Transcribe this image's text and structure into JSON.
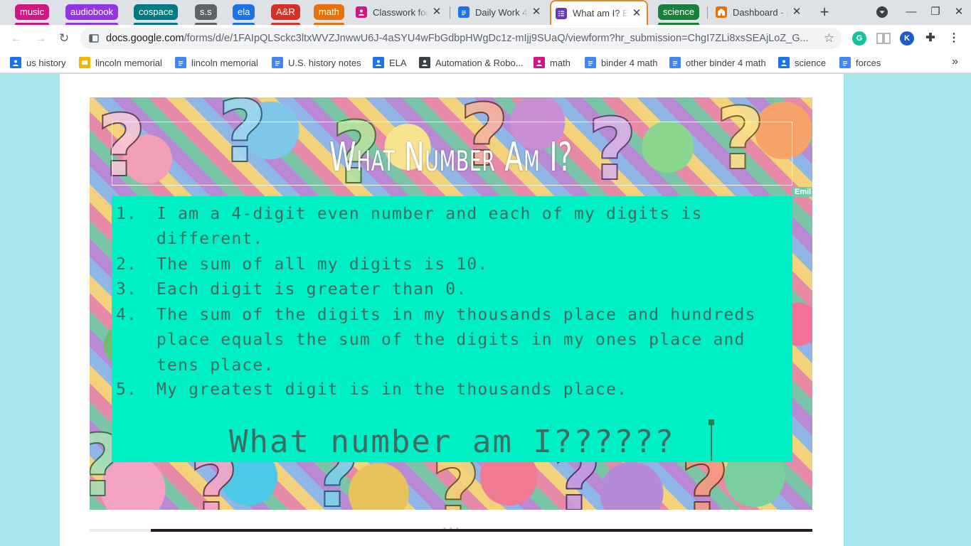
{
  "tab_groups": [
    {
      "label": "music",
      "color": "#d01884"
    },
    {
      "label": "audiobook",
      "color": "#9334e6"
    },
    {
      "label": "cospace",
      "color": "#007b83"
    },
    {
      "label": "s.s",
      "color": "#5f6368"
    },
    {
      "label": "ela",
      "color": "#1a73e8"
    },
    {
      "label": "A&R",
      "color": "#d93025"
    },
    {
      "label": "math",
      "color": "#e8710a"
    },
    {
      "label": "science",
      "color": "#188038"
    }
  ],
  "tabs": [
    {
      "title": "Classwork for",
      "favicon_color": "#d01884"
    },
    {
      "title": "Daily Work 4/",
      "favicon_color": "#1a73e8"
    },
    {
      "title": "What am I? E",
      "favicon_color": "#673ab7"
    },
    {
      "title": "Dashboard - I",
      "favicon_color": "#e8710a"
    }
  ],
  "toolbar": {
    "url_host": "docs.google.com",
    "url_path": "/forms/d/e/1FAIpQLSckc3ltxWVZJnwwU6J-4aSYU4wFbGdbpHWgDc1z-mIjj9SUaQ/viewform?hr_submission=ChgI7ZLi8xsSEAjLoZ_G..."
  },
  "extensions": [
    {
      "name": "grammarly-icon",
      "color": "#15c39a",
      "letter": "G"
    },
    {
      "name": "reading-list-icon",
      "color": "#ffffff",
      "letter": ""
    },
    {
      "name": "k-extension-icon",
      "color": "#1a5dc9",
      "letter": "K"
    }
  ],
  "bookmarks": [
    {
      "label": "us history",
      "icon": "classroom",
      "color": "#1a73e8"
    },
    {
      "label": "lincoln memorial",
      "icon": "slides",
      "color": "#f4b400"
    },
    {
      "label": "lincoln memorial",
      "icon": "docs",
      "color": "#4285f4"
    },
    {
      "label": "U.S. history notes",
      "icon": "docs",
      "color": "#4285f4"
    },
    {
      "label": "ELA",
      "icon": "classroom",
      "color": "#1a73e8"
    },
    {
      "label": "Automation & Robo...",
      "icon": "classroom",
      "color": "#3c4043"
    },
    {
      "label": "math",
      "icon": "classroom",
      "color": "#d01884"
    },
    {
      "label": "binder 4 math",
      "icon": "docs",
      "color": "#4285f4"
    },
    {
      "label": "other binder 4 math",
      "icon": "docs",
      "color": "#4285f4"
    },
    {
      "label": "science",
      "icon": "classroom",
      "color": "#1a73e8"
    },
    {
      "label": "forces",
      "icon": "docs",
      "color": "#4285f4"
    }
  ],
  "form": {
    "header_title": "What Number Am I?",
    "edge_label": "Emil",
    "clues": [
      {
        "num": "1.",
        "text": "I am a 4-digit even number and each of my digits is different."
      },
      {
        "num": "2.",
        "text": "The sum of all my digits is 10."
      },
      {
        "num": "3.",
        "text": "Each digit is greater than 0."
      },
      {
        "num": "4.",
        "text": "The sum of the digits in my thousands place and hundreds place equals the sum of the digits in my ones place and tens place."
      },
      {
        "num": "5.",
        "text": "My greatest digit is in the thousands place."
      }
    ],
    "question": "What number am I??????",
    "drag_handle": "• • •"
  },
  "colors": {
    "accent_card": "#00f0c6",
    "active_tab_border": "#e8852a",
    "page_background": "#a6e6ec"
  }
}
